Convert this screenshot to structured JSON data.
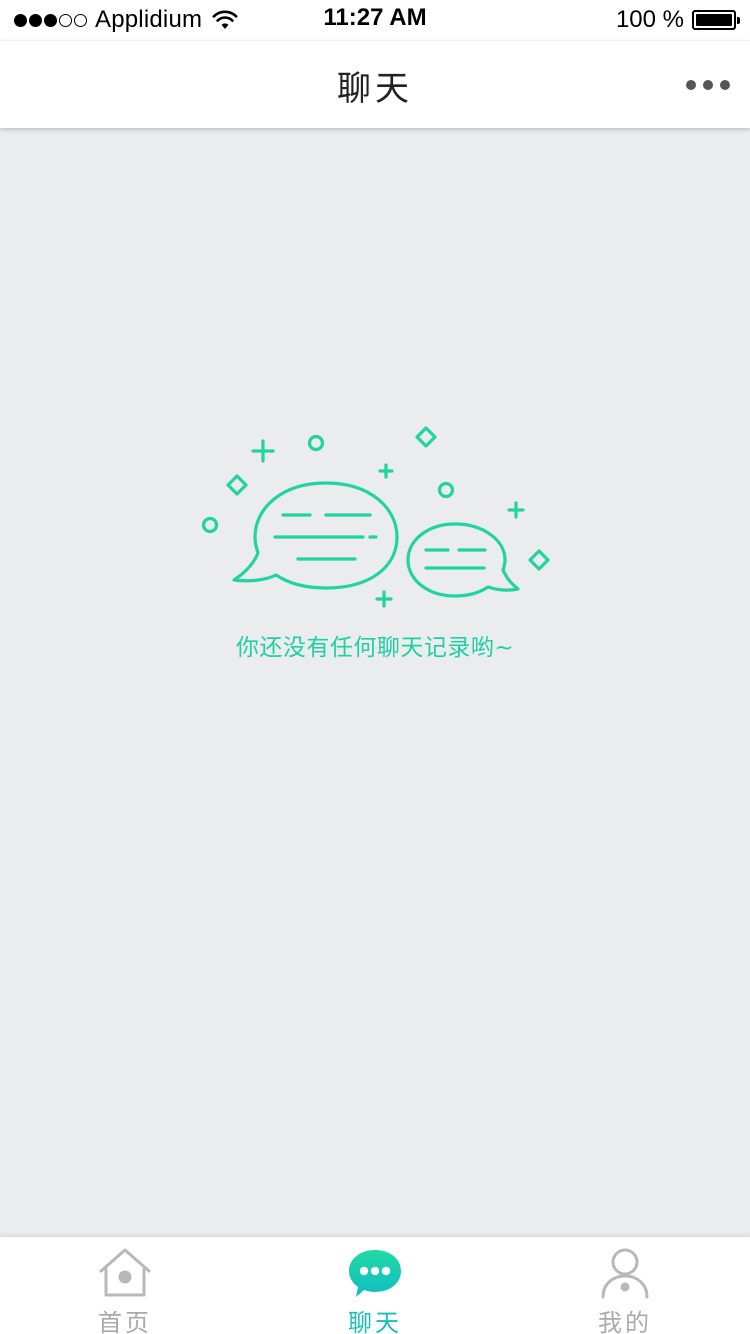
{
  "status_bar": {
    "carrier": "Applidium",
    "time": "11:27 AM",
    "battery": "100 %"
  },
  "nav": {
    "title": "聊天",
    "more_icon": "ellipsis-icon"
  },
  "empty_state": {
    "message": "你还没有任何聊天记录哟~",
    "icon": "chat-bubbles-illustration",
    "accent_color": "#20d39f"
  },
  "tab_bar": {
    "tabs": [
      {
        "label": "首页",
        "icon": "home-icon",
        "active": false
      },
      {
        "label": "聊天",
        "icon": "chat-icon",
        "active": true
      },
      {
        "label": "我的",
        "icon": "user-icon",
        "active": false
      }
    ],
    "active_color": "#18c0b8",
    "inactive_color": "#aaaaaa"
  }
}
